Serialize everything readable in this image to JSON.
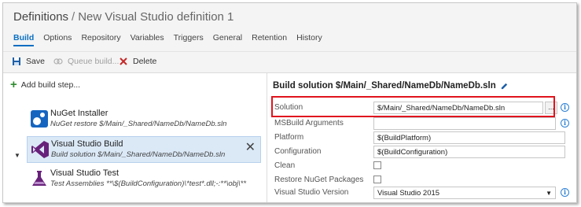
{
  "breadcrumb": {
    "root": "Definitions",
    "separator": "/",
    "current": "New Visual Studio definition 1"
  },
  "tabs": [
    {
      "label": "Build",
      "active": true
    },
    {
      "label": "Options"
    },
    {
      "label": "Repository"
    },
    {
      "label": "Variables"
    },
    {
      "label": "Triggers"
    },
    {
      "label": "General"
    },
    {
      "label": "Retention"
    },
    {
      "label": "History"
    }
  ],
  "toolbar": {
    "save_label": "Save",
    "queue_label": "Queue build...",
    "delete_label": "Delete"
  },
  "left": {
    "add_step_label": "Add build step..."
  },
  "steps": [
    {
      "title": "NuGet Installer",
      "subtitle": "NuGet restore $/Main/_Shared/NameDb/NameDb.sln",
      "icon": "nuget-icon"
    },
    {
      "title": "Visual Studio Build",
      "subtitle": "Build solution $/Main/_Shared/NameDb/NameDb.sln",
      "icon": "visual-studio-icon",
      "selected": true
    },
    {
      "title": "Visual Studio Test",
      "subtitle": "Test Assemblies **\\$(BuildConfiguration)\\*test*.dll;-:**\\obj\\**",
      "icon": "flask-icon"
    }
  ],
  "details": {
    "title": "Build solution $/Main/_Shared/NameDb/NameDb.sln",
    "fields": {
      "solution": {
        "label": "Solution",
        "value": "$/Main/_Shared/NameDb/NameDb.sln",
        "browse_label": "..."
      },
      "msbuild_args": {
        "label": "MSBuild Arguments",
        "value": ""
      },
      "platform": {
        "label": "Platform",
        "value": "$(BuildPlatform)"
      },
      "configuration": {
        "label": "Configuration",
        "value": "$(BuildConfiguration)"
      },
      "clean": {
        "label": "Clean",
        "checked": false
      },
      "restore_nuget": {
        "label": "Restore NuGet Packages",
        "checked": false
      },
      "vs_version": {
        "label": "Visual Studio Version",
        "value": "Visual Studio 2015"
      }
    },
    "info_glyph": "i"
  },
  "colors": {
    "accent": "#0a6fc2",
    "highlight": "#e0141e",
    "selected_bg": "#dbe9f7",
    "add_green": "#2e8b2e",
    "vs_purple": "#68217a"
  }
}
